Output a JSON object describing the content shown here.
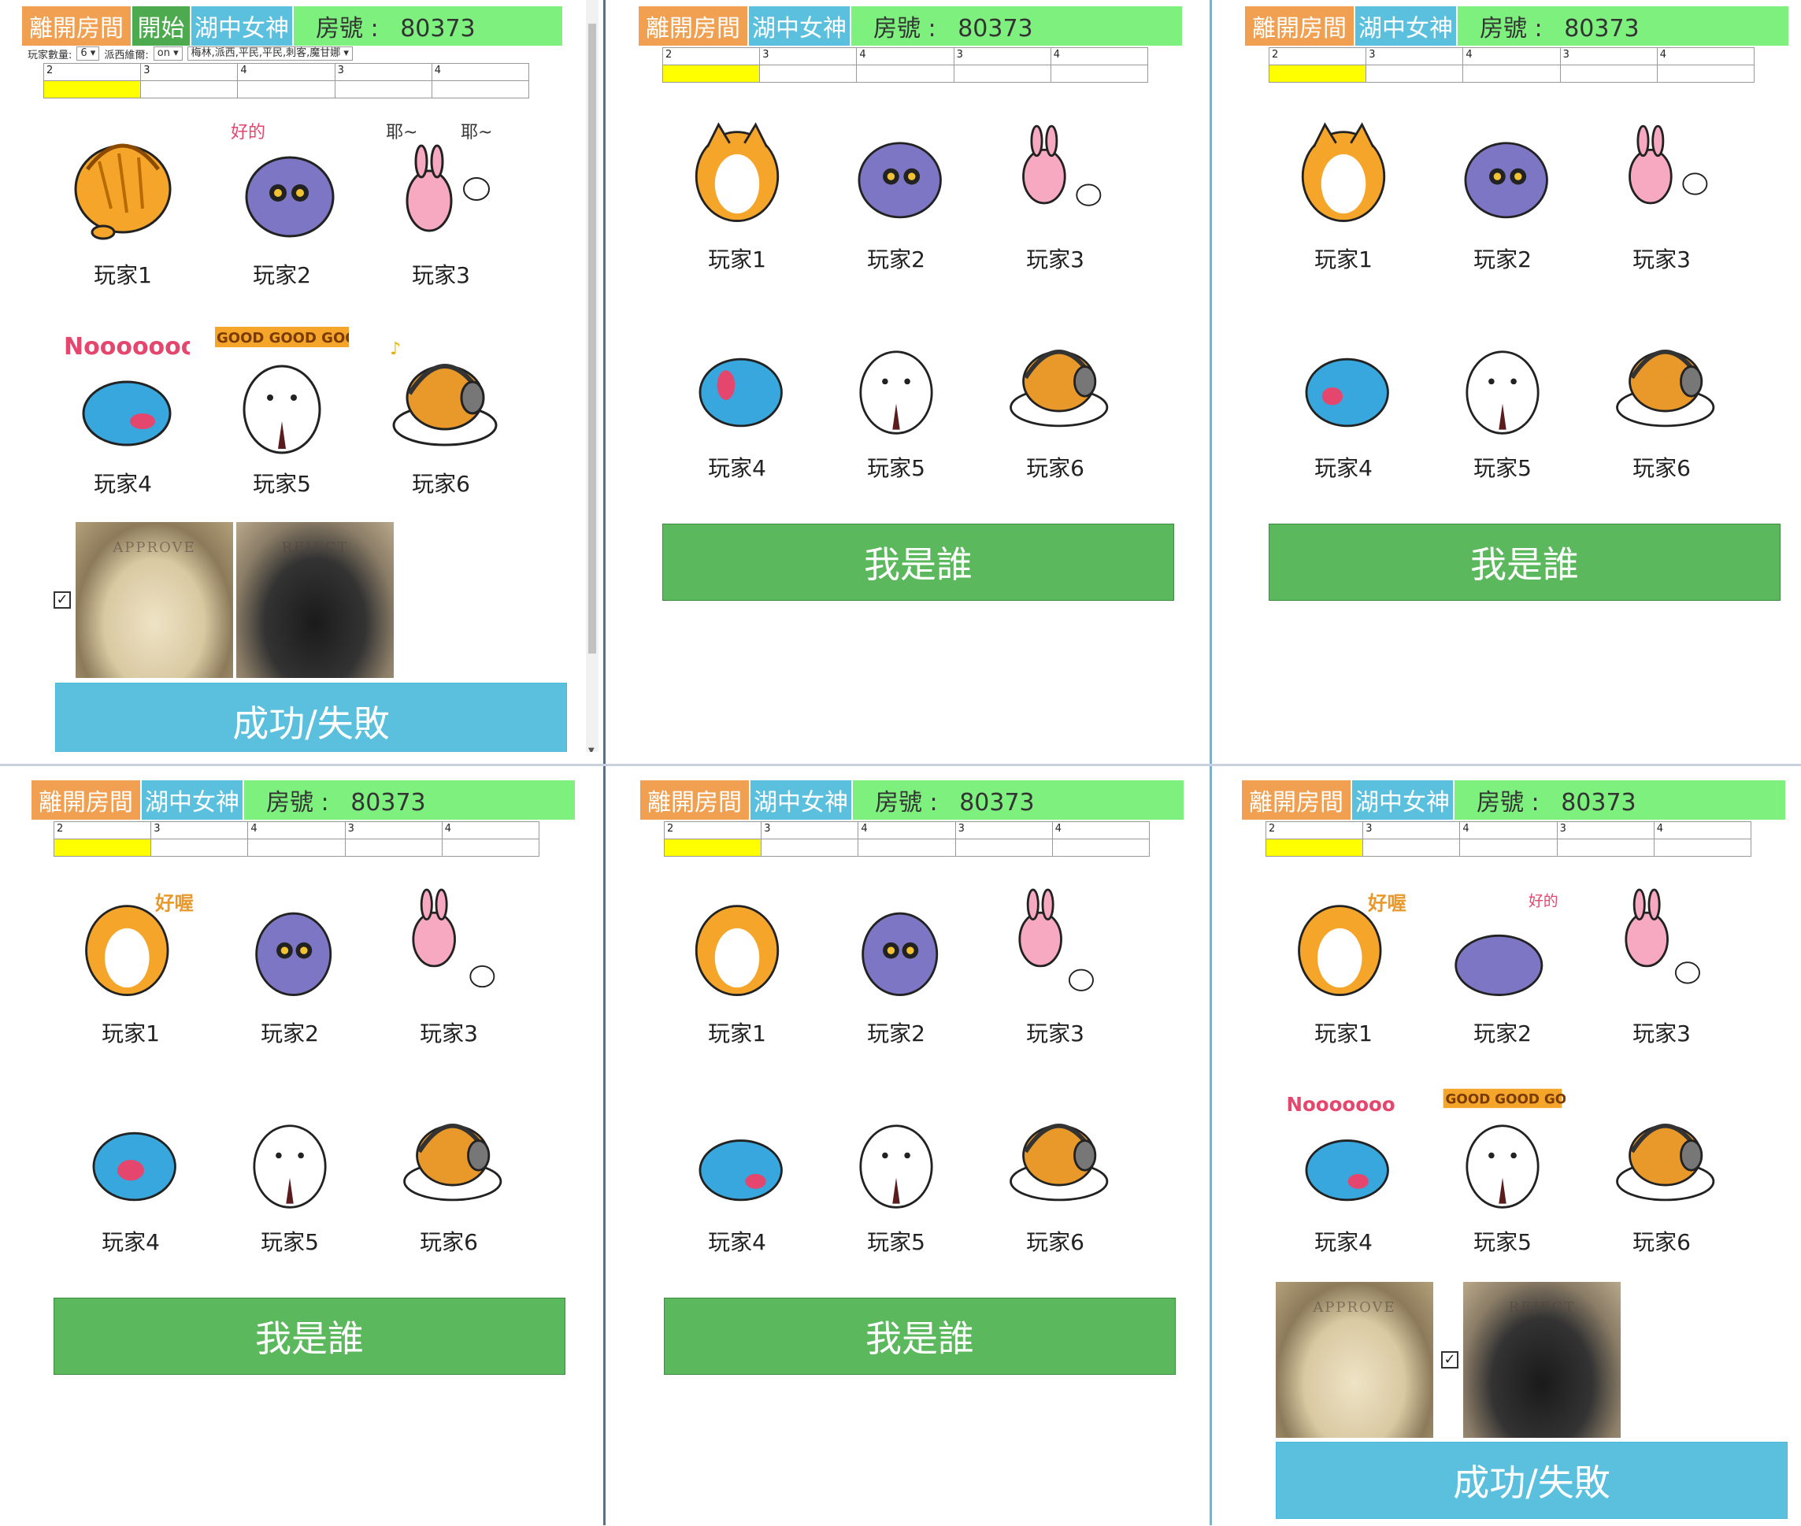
{
  "top": {
    "leave_label": "離開房間",
    "start_label": "開始",
    "lady_label": "湖中女神",
    "room_prefix": "房號",
    "room_colon": ":",
    "room_number": "80373"
  },
  "settings": {
    "player_count_label": "玩家數量:",
    "player_count_value": "6",
    "lancelot_label": "派西維爾:",
    "lancelot_value": "on",
    "roles_value": "梅林,派西,平民,平民,刺客,魔甘娜"
  },
  "quest_table": {
    "values": [
      "2",
      "3",
      "4",
      "3",
      "4"
    ]
  },
  "players": [
    {
      "label": "玩家1",
      "icon": "tiger-cat-icon"
    },
    {
      "label": "玩家2",
      "icon": "purple-bird-icon"
    },
    {
      "label": "玩家3",
      "icon": "pink-rabbit-icon"
    },
    {
      "label": "玩家4",
      "icon": "blue-cat-icon"
    },
    {
      "label": "玩家5",
      "icon": "white-bear-icon"
    },
    {
      "label": "玩家6",
      "icon": "egg-headphone-icon"
    }
  ],
  "buttons": {
    "who_am_i": "我是誰",
    "success_fail": "成功/失敗"
  },
  "vote": {
    "approve": "APPROVE",
    "reject": "REJECT"
  },
  "stickers": {
    "yeah": "耶~",
    "good": "好的",
    "ok": "好喔",
    "no": "Nooooooo",
    "goodgood": "GOOD GOOD GOOD"
  },
  "colors": {
    "topbar": "#7ef07e",
    "leave": "#f0a050",
    "start": "#4eaa4e",
    "lady": "#5bc0de",
    "green_button": "#5cb85c",
    "blue_button": "#5bc0de",
    "highlight": "#ffff00"
  }
}
